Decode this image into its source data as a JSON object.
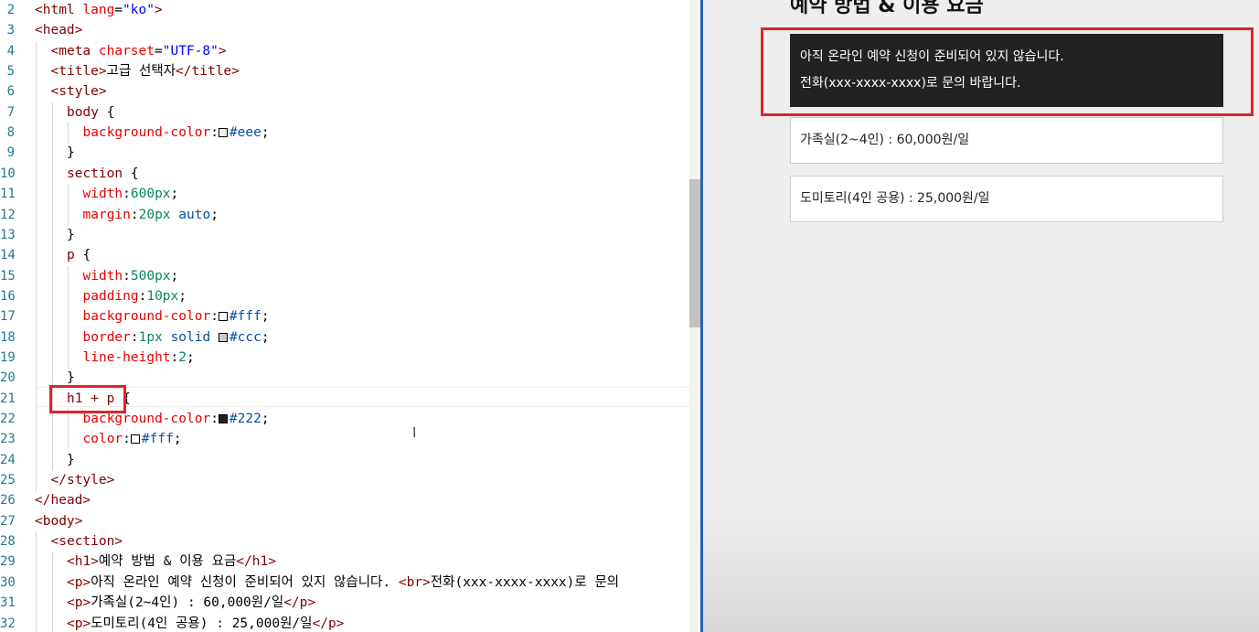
{
  "editor": {
    "lines": [
      {
        "n": "2",
        "indent": 0,
        "parts": [
          [
            "t-tag",
            "<html "
          ],
          [
            "t-attr",
            "lang"
          ],
          [
            "t-txt",
            "="
          ],
          [
            "t-str",
            "\"ko\""
          ],
          [
            "t-tag",
            ">"
          ]
        ]
      },
      {
        "n": "3",
        "indent": 0,
        "parts": [
          [
            "t-tag",
            "<head>"
          ]
        ]
      },
      {
        "n": "4",
        "indent": 1,
        "parts": [
          [
            "t-tag",
            "<meta "
          ],
          [
            "t-attr",
            "charset"
          ],
          [
            "t-txt",
            "="
          ],
          [
            "t-str",
            "\"UTF-8\""
          ],
          [
            "t-tag",
            ">"
          ]
        ]
      },
      {
        "n": "5",
        "indent": 1,
        "parts": [
          [
            "t-tag",
            "<title>"
          ],
          [
            "t-txt",
            "고급 선택자"
          ],
          [
            "t-tag",
            "</title>"
          ]
        ]
      },
      {
        "n": "6",
        "indent": 1,
        "parts": [
          [
            "t-tag",
            "<style>"
          ]
        ]
      },
      {
        "n": "7",
        "indent": 2,
        "parts": [
          [
            "t-sel",
            "body"
          ],
          [
            "t-txt",
            " {"
          ]
        ]
      },
      {
        "n": "8",
        "indent": 3,
        "parts": [
          [
            "t-prop",
            "background-color"
          ],
          [
            "t-txt",
            ":"
          ],
          [
            "swatch",
            "#eeeeee"
          ],
          [
            "t-val",
            "#eee"
          ],
          [
            "t-txt",
            ";"
          ]
        ]
      },
      {
        "n": "9",
        "indent": 2,
        "parts": [
          [
            "t-txt",
            "}"
          ]
        ]
      },
      {
        "n": "10",
        "indent": 2,
        "parts": [
          [
            "t-sel",
            "section"
          ],
          [
            "t-txt",
            " {"
          ]
        ]
      },
      {
        "n": "11",
        "indent": 3,
        "parts": [
          [
            "t-prop",
            "width"
          ],
          [
            "t-txt",
            ":"
          ],
          [
            "t-num",
            "600px"
          ],
          [
            "t-txt",
            ";"
          ]
        ]
      },
      {
        "n": "12",
        "indent": 3,
        "parts": [
          [
            "t-prop",
            "margin"
          ],
          [
            "t-txt",
            ":"
          ],
          [
            "t-num",
            "20px"
          ],
          [
            "t-txt",
            " "
          ],
          [
            "t-val",
            "auto"
          ],
          [
            "t-txt",
            ";"
          ]
        ]
      },
      {
        "n": "13",
        "indent": 2,
        "parts": [
          [
            "t-txt",
            "}"
          ]
        ]
      },
      {
        "n": "14",
        "indent": 2,
        "parts": [
          [
            "t-sel",
            "p"
          ],
          [
            "t-txt",
            " {"
          ]
        ]
      },
      {
        "n": "15",
        "indent": 3,
        "parts": [
          [
            "t-prop",
            "width"
          ],
          [
            "t-txt",
            ":"
          ],
          [
            "t-num",
            "500px"
          ],
          [
            "t-txt",
            ";"
          ]
        ]
      },
      {
        "n": "16",
        "indent": 3,
        "parts": [
          [
            "t-prop",
            "padding"
          ],
          [
            "t-txt",
            ":"
          ],
          [
            "t-num",
            "10px"
          ],
          [
            "t-txt",
            ";"
          ]
        ]
      },
      {
        "n": "17",
        "indent": 3,
        "parts": [
          [
            "t-prop",
            "background-color"
          ],
          [
            "t-txt",
            ":"
          ],
          [
            "swatch",
            "#ffffff"
          ],
          [
            "t-val",
            "#fff"
          ],
          [
            "t-txt",
            ";"
          ]
        ]
      },
      {
        "n": "18",
        "indent": 3,
        "parts": [
          [
            "t-prop",
            "border"
          ],
          [
            "t-txt",
            ":"
          ],
          [
            "t-num",
            "1px"
          ],
          [
            "t-txt",
            " "
          ],
          [
            "t-val",
            "solid"
          ],
          [
            "t-txt",
            " "
          ],
          [
            "swatch",
            "#cccccc"
          ],
          [
            "t-val",
            "#ccc"
          ],
          [
            "t-txt",
            ";"
          ]
        ]
      },
      {
        "n": "19",
        "indent": 3,
        "parts": [
          [
            "t-prop",
            "line-height"
          ],
          [
            "t-txt",
            ":"
          ],
          [
            "t-num",
            "2"
          ],
          [
            "t-txt",
            ";"
          ]
        ]
      },
      {
        "n": "20",
        "indent": 2,
        "parts": [
          [
            "t-txt",
            "}"
          ]
        ]
      },
      {
        "n": "21",
        "indent": 2,
        "parts": [
          [
            "t-sel",
            "h1 + p"
          ],
          [
            "t-txt",
            " {"
          ]
        ]
      },
      {
        "n": "22",
        "indent": 3,
        "parts": [
          [
            "t-prop",
            "background-color"
          ],
          [
            "t-txt",
            ":"
          ],
          [
            "swatch",
            "#222222"
          ],
          [
            "t-val",
            "#222"
          ],
          [
            "t-txt",
            ";"
          ]
        ]
      },
      {
        "n": "23",
        "indent": 3,
        "parts": [
          [
            "t-prop",
            "color"
          ],
          [
            "t-txt",
            ":"
          ],
          [
            "swatch",
            "#ffffff"
          ],
          [
            "t-val",
            "#fff"
          ],
          [
            "t-txt",
            ";"
          ]
        ]
      },
      {
        "n": "24",
        "indent": 2,
        "parts": [
          [
            "t-txt",
            "}"
          ]
        ]
      },
      {
        "n": "25",
        "indent": 1,
        "parts": [
          [
            "t-tag",
            "</style>"
          ]
        ]
      },
      {
        "n": "26",
        "indent": 0,
        "parts": [
          [
            "t-tag",
            "</head>"
          ]
        ]
      },
      {
        "n": "27",
        "indent": 0,
        "parts": [
          [
            "t-tag",
            "<body>"
          ]
        ]
      },
      {
        "n": "28",
        "indent": 1,
        "parts": [
          [
            "t-tag",
            "<section>"
          ]
        ]
      },
      {
        "n": "29",
        "indent": 2,
        "parts": [
          [
            "t-tag",
            "<h1>"
          ],
          [
            "t-txt",
            "예약 방법 & 이용 요금"
          ],
          [
            "t-tag",
            "</h1>"
          ]
        ]
      },
      {
        "n": "30",
        "indent": 2,
        "parts": [
          [
            "t-tag",
            "<p>"
          ],
          [
            "t-txt",
            "아직 온라인 예약 신청이 준비되어 있지 않습니다. "
          ],
          [
            "t-tag",
            "<br>"
          ],
          [
            "t-txt",
            "전화(xxx-xxxx-xxxx)로 문의"
          ]
        ]
      },
      {
        "n": "31",
        "indent": 2,
        "parts": [
          [
            "t-tag",
            "<p>"
          ],
          [
            "t-txt",
            "가족실(2~4인) : 60,000원/일"
          ],
          [
            "t-tag",
            "</p>"
          ]
        ]
      },
      {
        "n": "32",
        "indent": 2,
        "parts": [
          [
            "t-tag",
            "<p>"
          ],
          [
            "t-txt",
            "도미토리(4인 공용) : 25,000원/일"
          ],
          [
            "t-tag",
            "</p>"
          ]
        ]
      }
    ]
  },
  "preview": {
    "heading": "예약 방법 & 이용 요금",
    "notice_line1": "아직 온라인 예약 신청이 준비되어 있지 않습니다.",
    "notice_line2": "전화(xxx-xxxx-xxxx)로 문의 바랍니다.",
    "family_room": "가족실(2~4인) : 60,000원/일",
    "dormitory": "도미토리(4인 공용) : 25,000원/일"
  },
  "colors": {
    "highlight": "#e0242a",
    "divider": "#2a62b0"
  }
}
